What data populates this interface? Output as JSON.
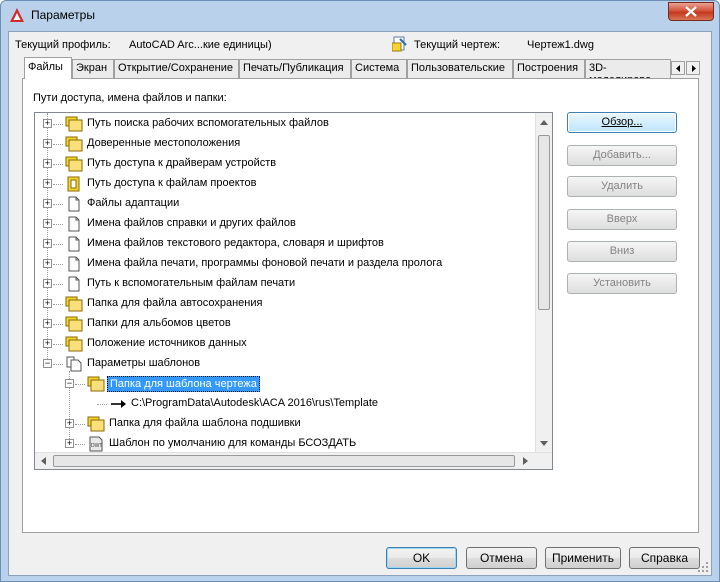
{
  "window": {
    "title": "Параметры"
  },
  "header": {
    "profile_label": "Текущий профиль:",
    "profile_value": "AutoCAD Arc...кие единицы)",
    "drawing_label": "Текущий чертеж:",
    "drawing_value": "Чертеж1.dwg"
  },
  "tabs": [
    {
      "label": "Файлы",
      "active": true
    },
    {
      "label": "Экран"
    },
    {
      "label": "Открытие/Сохранение"
    },
    {
      "label": "Печать/Публикация"
    },
    {
      "label": "Система"
    },
    {
      "label": "Пользовательские"
    },
    {
      "label": "Построения"
    },
    {
      "label": "3D-моделирова"
    }
  ],
  "files": {
    "section_label": "Пути доступа, имена файлов и папки:",
    "tree": [
      {
        "label": "Путь поиска рабочих вспомогательных файлов",
        "icon": "folder-stack-icon",
        "expander": "+"
      },
      {
        "label": "Доверенные местоположения",
        "icon": "folder-stack-icon",
        "expander": "+"
      },
      {
        "label": "Путь доступа к драйверам устройств",
        "icon": "folder-stack-icon",
        "expander": "+"
      },
      {
        "label": "Путь доступа к файлам проектов",
        "icon": "project-file-icon",
        "expander": "+"
      },
      {
        "label": "Файлы адаптации",
        "icon": "document-icon",
        "expander": "+"
      },
      {
        "label": "Имена файлов справки и других файлов",
        "icon": "document-icon",
        "expander": "+"
      },
      {
        "label": "Имена файлов текстового редактора, словаря и шрифтов",
        "icon": "document-icon",
        "expander": "+"
      },
      {
        "label": "Имена файла печати, программы фоновой печати и раздела пролога",
        "icon": "document-icon",
        "expander": "+"
      },
      {
        "label": "Путь к вспомогательным файлам печати",
        "icon": "document-icon",
        "expander": "+"
      },
      {
        "label": "Папка для файла автосохранения",
        "icon": "folder-stack-icon",
        "expander": "+"
      },
      {
        "label": "Папки для альбомов цветов",
        "icon": "folder-stack-icon",
        "expander": "+"
      },
      {
        "label": "Положение источников данных",
        "icon": "folder-stack-icon",
        "expander": "+"
      },
      {
        "label": "Параметры шаблонов",
        "icon": "document-stack-icon",
        "expander": "−"
      },
      {
        "label": "Папка для шаблона чертежа",
        "icon": "folder-stack-icon",
        "expander": "−",
        "selected": true
      },
      {
        "label": "C:\\ProgramData\\Autodesk\\ACA 2016\\rus\\Template",
        "icon": "arrow-right-icon"
      },
      {
        "label": "Папка для файла шаблона подшивки",
        "icon": "folder-stack-icon",
        "expander": "+"
      },
      {
        "label": "Шаблон по умолчанию для команды БСОЗДАТЬ",
        "icon": "dwt-file-icon",
        "expander": "+"
      }
    ],
    "buttons": {
      "browse": "Обзор...",
      "add": "Добавить...",
      "remove": "Удалить",
      "up": "Вверх",
      "down": "Вниз",
      "set_current": "Установить"
    }
  },
  "footer": {
    "ok": "OK",
    "cancel": "Отмена",
    "apply": "Применить",
    "help": "Справка"
  },
  "colors": {
    "selection": "#3399ff",
    "folder": "#f5d432",
    "titlebar": "#b9d1ea",
    "close": "#c3381c"
  }
}
